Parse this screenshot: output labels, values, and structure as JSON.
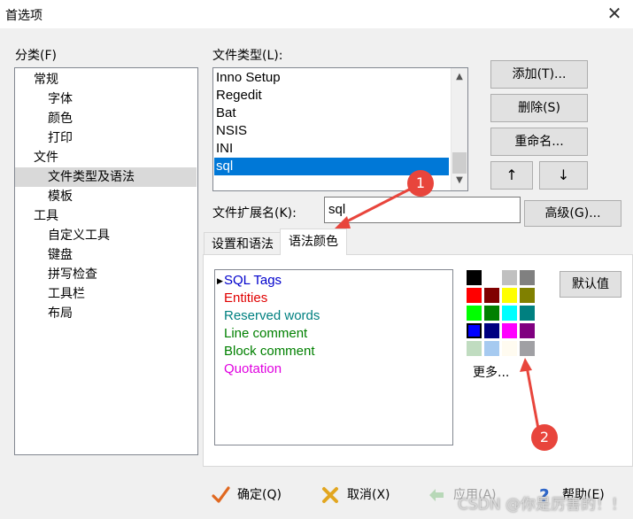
{
  "window": {
    "title": "首选项",
    "close_glyph": "✕"
  },
  "category": {
    "label": "分类(F)",
    "items": [
      {
        "label": "常规",
        "level": 0
      },
      {
        "label": "字体",
        "level": 1
      },
      {
        "label": "颜色",
        "level": 1
      },
      {
        "label": "打印",
        "level": 1
      },
      {
        "label": "文件",
        "level": 0
      },
      {
        "label": "文件类型及语法",
        "level": 1,
        "selected": true
      },
      {
        "label": "模板",
        "level": 1
      },
      {
        "label": "工具",
        "level": 0
      },
      {
        "label": "自定义工具",
        "level": 1
      },
      {
        "label": "键盘",
        "level": 1
      },
      {
        "label": "拼写检查",
        "level": 1
      },
      {
        "label": "工具栏",
        "level": 1
      },
      {
        "label": "布局",
        "level": 1
      }
    ]
  },
  "file_types": {
    "label": "文件类型(L):",
    "items": [
      "Inno Setup",
      "Regedit",
      "Bat",
      "NSIS",
      "INI",
      "sql"
    ],
    "selected": "sql"
  },
  "buttons": {
    "add": "添加(T)...",
    "delete": "删除(S)",
    "rename": "重命名...",
    "up": "↑",
    "down": "↓",
    "advanced": "高级(G)...",
    "default_value": "默认值"
  },
  "extension": {
    "label": "文件扩展名(K):",
    "value": "sql"
  },
  "tabs": [
    {
      "label": "设置和语法",
      "active": false
    },
    {
      "label": "语法颜色",
      "active": true
    }
  ],
  "syntax_elements": [
    {
      "label": "SQL Tags",
      "color": "#0000cc",
      "selected": true
    },
    {
      "label": "Entities",
      "color": "#e00000"
    },
    {
      "label": "Reserved words",
      "color": "#008080"
    },
    {
      "label": "Line comment",
      "color": "#008000"
    },
    {
      "label": "Block comment",
      "color": "#008000"
    },
    {
      "label": "Quotation",
      "color": "#e000e0"
    }
  ],
  "palette": {
    "colors": [
      "#000000",
      "#ffffff",
      "#c0c0c0",
      "#808080",
      "#ff0000",
      "#800000",
      "#ffff00",
      "#808000",
      "#00ff00",
      "#008000",
      "#00ffff",
      "#008080",
      "#0000ff",
      "#000080",
      "#ff00ff",
      "#800080",
      "#c0dcc0",
      "#a6caf0",
      "#fffbf0",
      "#a0a0a4"
    ],
    "selected_index": 12,
    "more_label": "更多..."
  },
  "bottom": {
    "ok": "确定(Q)",
    "cancel": "取消(X)",
    "apply": "应用(A)",
    "help": "帮助(E)"
  },
  "annotations": {
    "badge1": "1",
    "badge2": "2"
  },
  "watermark": "CSDN @你是厉害的！！"
}
